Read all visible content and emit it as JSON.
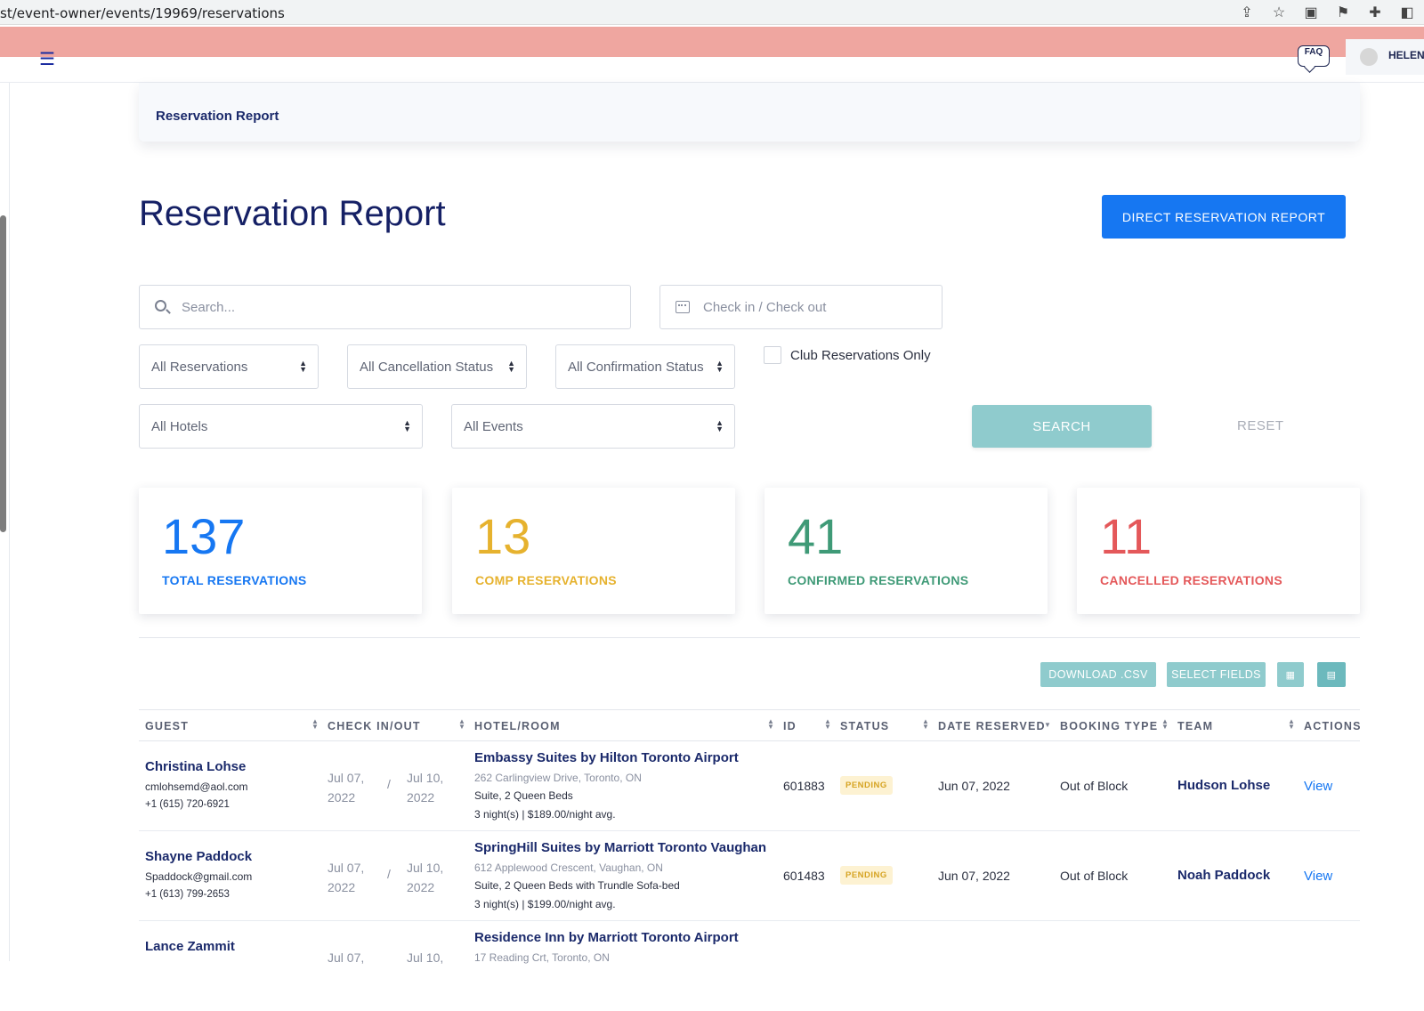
{
  "browser": {
    "url": "st/event-owner/events/19969/reservations"
  },
  "header": {
    "faq_label": "FAQ",
    "user_name": "HELEN"
  },
  "breadcrumb": "Reservation Report",
  "page_title": "Reservation Report",
  "direct_button": "DIRECT RESERVATION REPORT",
  "filters": {
    "search_placeholder": "Search...",
    "date_placeholder": "Check in / Check out",
    "reservations": "All Reservations",
    "cancellation": "All Cancellation Status",
    "confirmation": "All Confirmation Status",
    "club_only": "Club Reservations Only",
    "hotels": "All Hotels",
    "events": "All Events",
    "search_button": "SEARCH",
    "reset_button": "RESET"
  },
  "stats": [
    {
      "value": "137",
      "label": "TOTAL RESERVATIONS",
      "color": "#1677f2"
    },
    {
      "value": "13",
      "label": "COMP RESERVATIONS",
      "color": "#e6b22e"
    },
    {
      "value": "41",
      "label": "CONFIRMED RESERVATIONS",
      "color": "#3f9a77"
    },
    {
      "value": "11",
      "label": "CANCELLED RESERVATIONS",
      "color": "#e4585a"
    }
  ],
  "toolbar": {
    "download": "DOWNLOAD .CSV",
    "select_fields": "SELECT FIELDS"
  },
  "table": {
    "headers": [
      "GUEST",
      "CHECK IN/OUT",
      "HOTEL/ROOM",
      "ID",
      "STATUS",
      "DATE RESERVED",
      "BOOKING TYPE",
      "TEAM",
      "ACTIONS"
    ],
    "rows": [
      {
        "guest": "Christina Lohse",
        "email": "cmlohsemd@aol.com",
        "phone": "+1 (615) 720-6921",
        "checkin_md": "Jul 07,",
        "checkin_y": "2022",
        "checkout_md": "Jul 10,",
        "checkout_y": "2022",
        "hotel": "Embassy Suites by Hilton Toronto Airport",
        "address": "262 Carlingview Drive, Toronto, ON",
        "room": "Suite, 2 Queen Beds",
        "nights": "3 night(s) | $189.00/night avg.",
        "id": "601883",
        "status": "PENDING",
        "date_reserved": "Jun 07, 2022",
        "booking_type": "Out of Block",
        "team": "Hudson Lohse",
        "action": "View"
      },
      {
        "guest": "Shayne Paddock",
        "email": "Spaddock@gmail.com",
        "phone": "+1 (613) 799-2653",
        "checkin_md": "Jul 07,",
        "checkin_y": "2022",
        "checkout_md": "Jul 10,",
        "checkout_y": "2022",
        "hotel": "SpringHill Suites by Marriott Toronto Vaughan",
        "address": "612 Applewood Crescent, Vaughan, ON",
        "room": "Suite, 2 Queen Beds with Trundle Sofa-bed",
        "nights": "3 night(s) | $199.00/night avg.",
        "id": "601483",
        "status": "PENDING",
        "date_reserved": "Jun 07, 2022",
        "booking_type": "Out of Block",
        "team": "Noah Paddock",
        "action": "View"
      },
      {
        "guest": "Lance Zammit",
        "checkin_md": "Jul 07,",
        "checkout_md": "Jul 10,",
        "hotel": "Residence Inn by Marriott Toronto Airport",
        "address": "17 Reading Crt, Toronto, ON"
      }
    ]
  }
}
